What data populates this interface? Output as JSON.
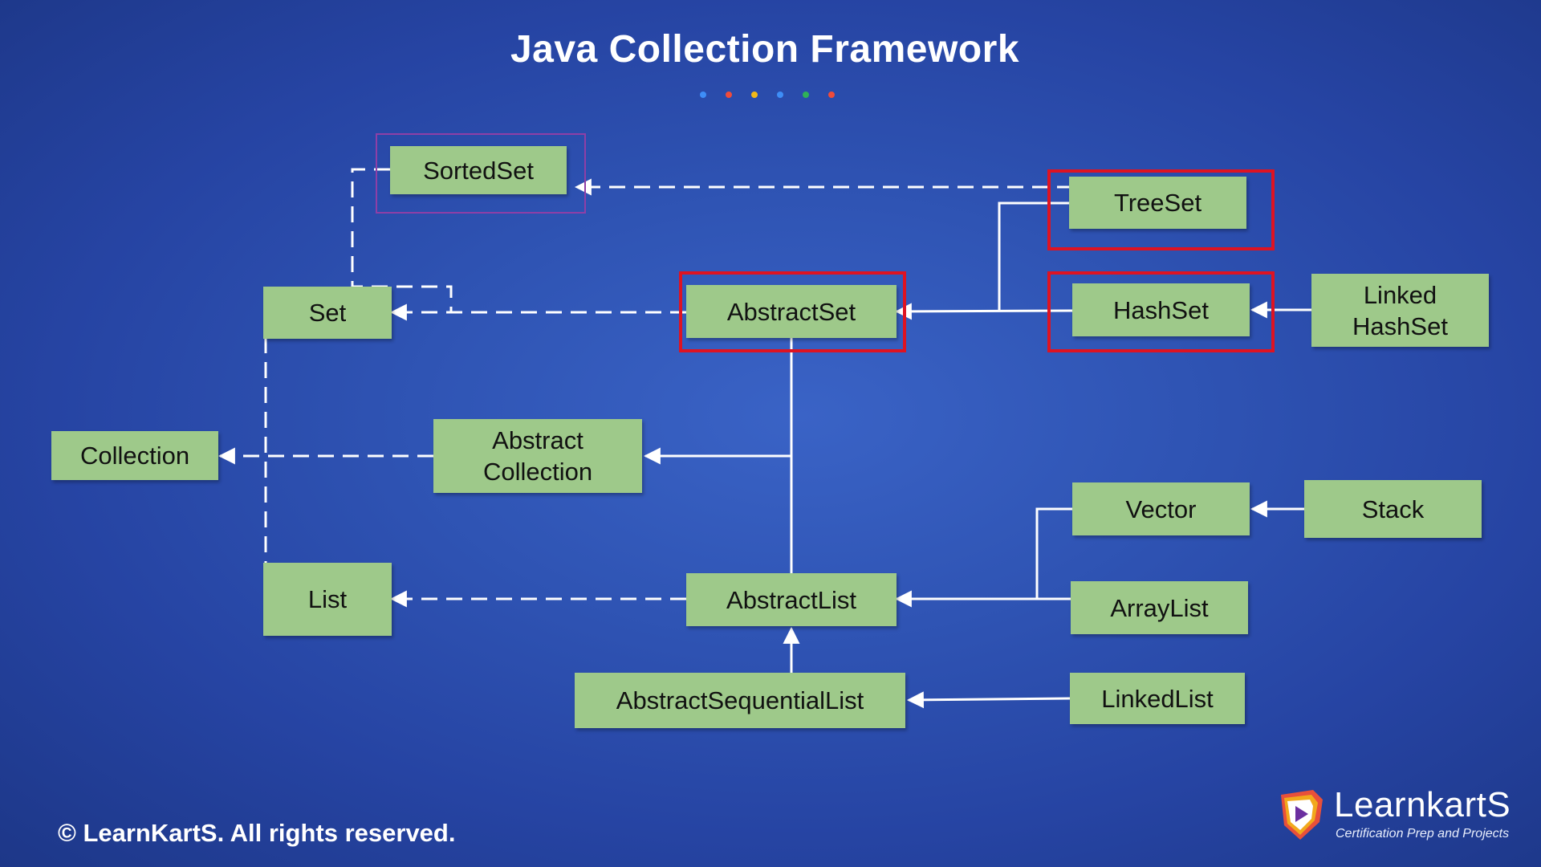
{
  "title": "Java Collection Framework",
  "decor_dot_colors": [
    "#3e8ef7",
    "#f04b3a",
    "#f2b818",
    "#3e8ef7",
    "#2fb257",
    "#f04b3a"
  ],
  "nodes": {
    "sortedset": "SortedSet",
    "treeset": "TreeSet",
    "set": "Set",
    "abstractset": "AbstractSet",
    "hashset": "HashSet",
    "linkedhashset": "Linked\nHashSet",
    "collection": "Collection",
    "abstractcollection": "Abstract\nCollection",
    "vector": "Vector",
    "stack": "Stack",
    "list": "List",
    "abstractlist": "AbstractList",
    "arraylist": "ArrayList",
    "abstractsequentiallist": "AbstractSequentialList",
    "linkedlist": "LinkedList"
  },
  "highlighted_nodes": [
    "SortedSet",
    "TreeSet",
    "AbstractSet",
    "HashSet"
  ],
  "edges": [
    {
      "from": "TreeSet",
      "to": "SortedSet",
      "style": "dashed"
    },
    {
      "from": "SortedSet",
      "to": "Set",
      "style": "dashed"
    },
    {
      "from": "AbstractSet",
      "to": "Set",
      "style": "dashed"
    },
    {
      "from": "TreeSet",
      "to": "AbstractSet",
      "style": "solid"
    },
    {
      "from": "HashSet",
      "to": "AbstractSet",
      "style": "solid"
    },
    {
      "from": "Linked HashSet",
      "to": "HashSet",
      "style": "solid"
    },
    {
      "from": "Set",
      "to": "Collection",
      "style": "dashed"
    },
    {
      "from": "List",
      "to": "Collection",
      "style": "dashed"
    },
    {
      "from": "Abstract Collection",
      "to": "Collection",
      "style": "dashed"
    },
    {
      "from": "AbstractSet",
      "to": "Abstract Collection",
      "style": "solid"
    },
    {
      "from": "AbstractList",
      "to": "Abstract Collection",
      "style": "solid"
    },
    {
      "from": "AbstractList",
      "to": "List",
      "style": "dashed"
    },
    {
      "from": "Vector",
      "to": "AbstractList",
      "style": "solid"
    },
    {
      "from": "ArrayList",
      "to": "AbstractList",
      "style": "solid"
    },
    {
      "from": "Stack",
      "to": "Vector",
      "style": "solid"
    },
    {
      "from": "AbstractSequentialList",
      "to": "AbstractList",
      "style": "solid"
    },
    {
      "from": "LinkedList",
      "to": "AbstractSequentialList",
      "style": "solid"
    }
  ],
  "footer": "© LearnKartS. All rights reserved.",
  "logo": {
    "name": "LearnkartS",
    "tagline": "Certification Prep and Projects"
  }
}
